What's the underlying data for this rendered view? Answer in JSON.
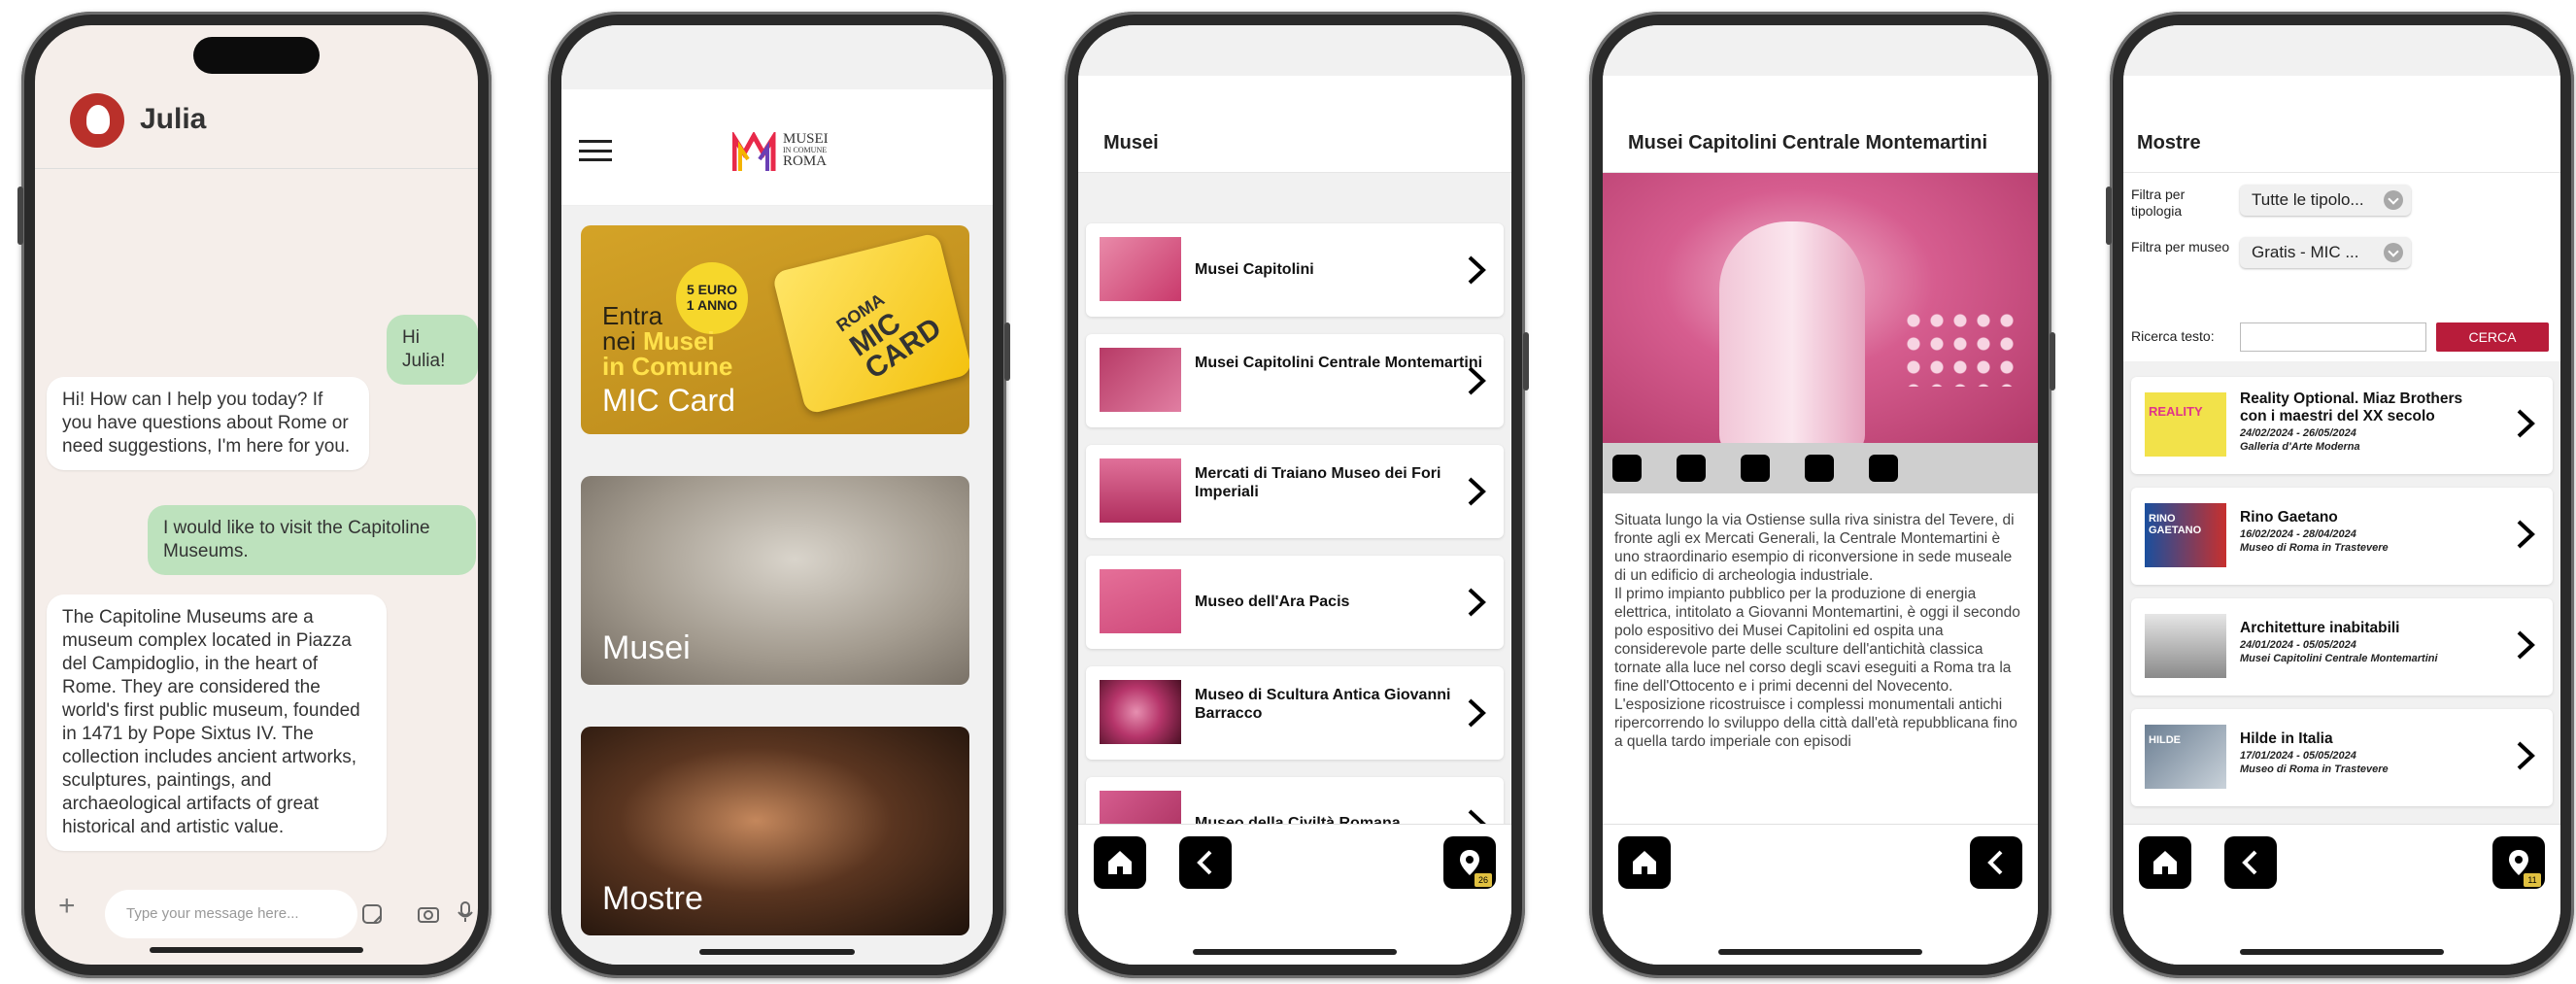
{
  "chat": {
    "name": "Julia",
    "messages": [
      {
        "from": "user",
        "text": "Hi Julia!"
      },
      {
        "from": "bot",
        "text": "Hi! How can I help you today? If you have questions about Rome or need suggestions, I'm here for you."
      },
      {
        "from": "user",
        "text": "I would like to visit the Capitoline Museums."
      },
      {
        "from": "bot",
        "text": "The Capitoline Museums are a museum complex located in Piazza del Campidoglio, in the heart of Rome. They are considered the world's first public museum, founded in 1471 by Pope Sixtus IV. The collection includes ancient artworks, sculptures, paintings, and archaeological artifacts of great historical and artistic value."
      }
    ],
    "input_placeholder": "Type your message here..."
  },
  "home": {
    "logo_line1": "MUSEI",
    "logo_line2": "IN COMUNE",
    "logo_line3": "ROMA",
    "mic_card": {
      "badge_line1": "5 EURO",
      "badge_line2": "1 ANNO",
      "entra_line1": "Entra",
      "entra_nei": "nei",
      "entra_musei": "Musei",
      "entra_comune": "in Comune",
      "label": "MIC Card",
      "card_text_1": "ROMA",
      "card_text_2": "MIC",
      "card_text_3": "CARD"
    },
    "cards": [
      {
        "label": "Musei"
      },
      {
        "label": "Mostre"
      }
    ]
  },
  "musei": {
    "title": "Musei",
    "items": [
      {
        "label": "Musei Capitolini"
      },
      {
        "label": "Musei Capitolini Centrale Montemartini"
      },
      {
        "label": "Mercati di Traiano Museo dei Fori Imperiali"
      },
      {
        "label": "Museo dell'Ara Pacis"
      },
      {
        "label": "Museo di Scultura Antica Giovanni Barracco"
      },
      {
        "label": "Museo della Civiltà Romana"
      }
    ],
    "pin_badge": "26"
  },
  "detail": {
    "title": "Musei Capitolini Centrale Montemartini",
    "text": "Situata lungo la via Ostiense sulla riva sinistra del Tevere, di fronte agli ex Mercati Generali, la Centrale Montemartini è uno straordinario esempio di riconversione in sede museale di un edificio di archeologia industriale.\nIl primo impianto pubblico per la produzione di energia elettrica, intitolato a Giovanni Montemartini, è oggi il secondo polo espositivo dei Musei Capitolini ed ospita una considerevole parte delle sculture dell'antichità classica tornate alla luce nel corso degli scavi eseguiti a Roma tra la fine dell'Ottocento e i primi decenni del Novecento.\nL'esposizione ricostruisce i complessi monumentali antichi ripercorrendo lo sviluppo della città dall'età repubblicana fino a quella tardo imperiale con episodi"
  },
  "mostre": {
    "title": "Mostre",
    "filter_tipologia_label": "Filtra per tipologia",
    "filter_tipologia_value": "Tutte le tipolo...",
    "filter_museo_label": "Filtra per museo",
    "filter_museo_value": "Gratis - MIC ...",
    "search_label": "Ricerca testo:",
    "search_button": "CERCA",
    "items": [
      {
        "title": "Reality Optional. Miaz Brothers con i maestri del XX secolo",
        "date": "24/02/2024 - 26/05/2024",
        "place": "Galleria d'Arte Moderna",
        "thumb_text": "REALITY"
      },
      {
        "title": "Rino Gaetano",
        "date": "16/02/2024 - 28/04/2024",
        "place": "Museo di Roma in Trastevere",
        "thumb_text": "RINO GAETANO"
      },
      {
        "title": "Architetture inabitabili",
        "date": "24/01/2024 - 05/05/2024",
        "place": "Musei Capitolini Centrale Montemartini",
        "thumb_text": ""
      },
      {
        "title": "Hilde in Italia",
        "date": "17/01/2024 - 05/05/2024",
        "place": "Museo di Roma in Trastevere",
        "thumb_text": "HILDE"
      }
    ],
    "pin_badge": "11"
  },
  "colors": {
    "accent_pink": "#d94a7c",
    "cerca_red": "#b81c3a",
    "chat_out": "#bde2bd",
    "mic_gold": "#d4a327"
  }
}
